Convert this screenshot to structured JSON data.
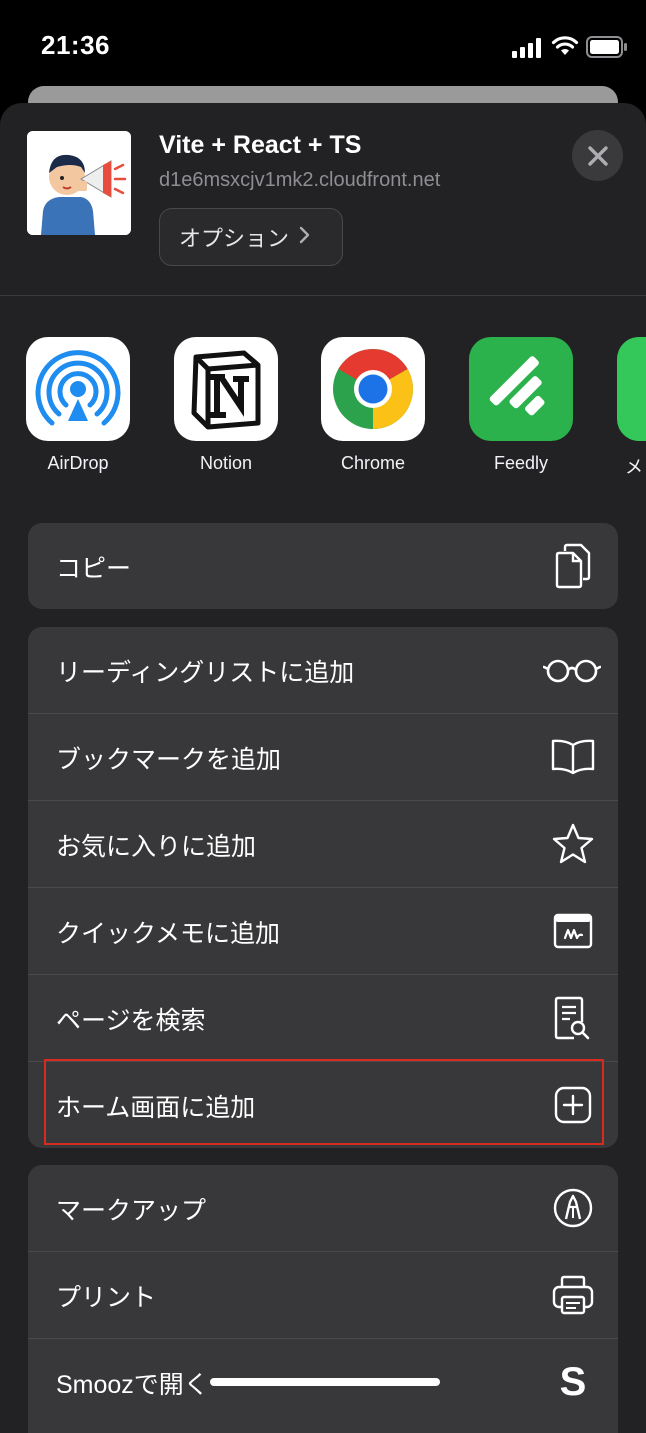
{
  "status_bar": {
    "time": "21:36"
  },
  "share_sheet": {
    "title": "Vite + React + TS",
    "url": "d1e6msxcjv1mk2.cloudfront.net",
    "options_label": "オプション",
    "apps": [
      {
        "label": "AirDrop",
        "icon": "airdrop-icon"
      },
      {
        "label": "Notion",
        "icon": "notion-icon"
      },
      {
        "label": "Chrome",
        "icon": "chrome-icon"
      },
      {
        "label": "Feedly",
        "icon": "feedly-icon"
      },
      {
        "label": "メ",
        "icon": "messages-icon"
      }
    ],
    "actions_group1": [
      {
        "label": "コピー",
        "icon": "copy-icon"
      }
    ],
    "actions_group2": [
      {
        "label": "リーディングリストに追加",
        "icon": "glasses-icon"
      },
      {
        "label": "ブックマークを追加",
        "icon": "book-icon"
      },
      {
        "label": "お気に入りに追加",
        "icon": "star-icon"
      },
      {
        "label": "クイックメモに追加",
        "icon": "quick-note-icon"
      },
      {
        "label": "ページを検索",
        "icon": "find-page-icon"
      },
      {
        "label": "ホーム画面に追加",
        "icon": "add-square-icon"
      }
    ],
    "actions_group3": [
      {
        "label": "マークアップ",
        "icon": "markup-icon"
      },
      {
        "label": "プリント",
        "icon": "printer-icon"
      },
      {
        "label": "Smoozで開く",
        "icon": "smooz-icon"
      }
    ]
  },
  "colors": {
    "highlight": "#d62b1e",
    "sheet_bg": "#222224",
    "row_bg": "#38383a"
  }
}
